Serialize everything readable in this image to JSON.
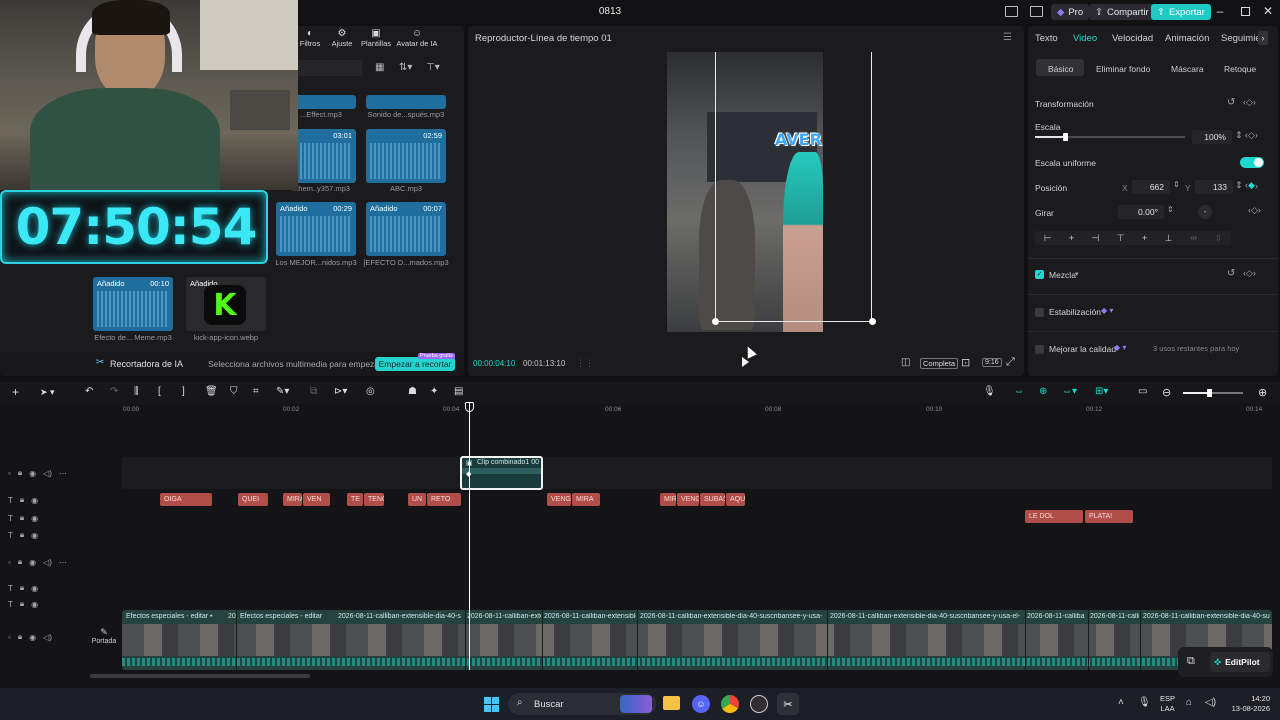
{
  "window": {
    "title": "0813"
  },
  "titlebar": {
    "pro_label": "Pro",
    "share_label": "Compartir",
    "export_label": "Exportar"
  },
  "media_toolbar": {
    "items": [
      "Filtros",
      "Ajuste",
      "Plantillas",
      "Avatar de IA"
    ]
  },
  "overlay": {
    "clock": "07:50:54"
  },
  "media": {
    "files": [
      {
        "name": "...Effect.mp3",
        "tag": "",
        "duration": ""
      },
      {
        "name": "Sonido de...spués.mp3",
        "tag": "",
        "duration": ""
      },
      {
        "name": "...hem..y357.mp3",
        "tag": "",
        "duration": "03:01"
      },
      {
        "name": "ABC.mp3",
        "tag": "",
        "duration": "02:59"
      },
      {
        "name": "Los MEJOR...nidos.mp3",
        "tag": "Añadido",
        "duration": "00:29"
      },
      {
        "name": "[EFECTO D...mados.mp3",
        "tag": "Añadido",
        "duration": "00:07"
      },
      {
        "name": "Efecto de... Meme.mp3",
        "tag": "Añadido",
        "duration": "00:10"
      },
      {
        "name": "kick-app-icon.webp",
        "tag": "Añadido",
        "duration": ""
      }
    ],
    "ai_cutter_label": "Recortadora de IA",
    "ai_cutter_hint": "Selecciona archivos multimedia para empezar",
    "ai_cutter_button": "Empezar a recortar",
    "ai_cutter_badge": "Prueba gratis"
  },
  "player": {
    "title": "Reproductor-Línea de tiempo 01",
    "current_time": "00:00:04:10",
    "total_time": "00:01:13:10",
    "overlay_text": "AVER",
    "full_label": "Completa",
    "ratio_label": "9:16"
  },
  "inspector": {
    "tabs": [
      "Texto",
      "Video",
      "Velocidad",
      "Animación",
      "Seguimie"
    ],
    "subtabs": [
      "Básico",
      "Eliminar fondo",
      "Máscara",
      "Retoque"
    ],
    "transform_label": "Transformación",
    "scale_label": "Escala",
    "scale_value": "100%",
    "scale_level": 0.2,
    "uniform_label": "Escala uniforme",
    "position_label": "Posición",
    "pos_x_label": "X",
    "pos_x": "662",
    "pos_y_label": "Y",
    "pos_y": "133",
    "rotate_label": "Girar",
    "rotate_value": "0.00°",
    "blend_label": "Mezcla",
    "stabilize_label": "Estabilización",
    "quality_label": "Mejorar la calidad",
    "quality_hint": "3 usos restantes para hoy"
  },
  "timeline": {
    "ruler": [
      "00:00",
      "00:02",
      "00:04",
      "00:06",
      "00:08",
      "00:10",
      "00:12",
      "00:14"
    ],
    "compound_clip": "Clip combinado1",
    "compound_dur": "00",
    "captions_row1": [
      "OIGA",
      "QUEI",
      "MIRA",
      "VEN",
      "TE",
      "TENG",
      "UN",
      "RETO",
      "VENG",
      "MIRA",
      "MIR",
      "VENG",
      "SUBAS",
      "AQUÍ"
    ],
    "captions_row2": [
      "LE DOL",
      "PLATA!"
    ],
    "cover_label": "Portada",
    "video_labels": [
      "Efectos especiales - editar •",
      "20",
      "Efectos especiales - editar",
      "2026-08-11-calliban-extensible-dia-40-s",
      "2026-08-11-calliban-exte",
      "2026-08-11-calliban-extensible",
      "2026-08-11-calliban-extensible-dia-40-suscribansee-y-usa-",
      "2026-08-11-calliban-extensible-dia-40-suscribansee-y-usa-el-",
      "2026-08-11-calliba",
      "2026-08-11-calli",
      "2026-08-11-calliban-extensible-dia-40-su"
    ],
    "editpilot_label": "EditPilot"
  },
  "taskbar": {
    "search": "Buscar",
    "lang": "ESP",
    "region": "LAA",
    "time": "14:20",
    "date": "13-08-2026"
  },
  "colors": {
    "accent": "#1ee0d6",
    "export": "#1fc9c4",
    "caption": "#b14e4a",
    "clock": "#3be8f5"
  }
}
